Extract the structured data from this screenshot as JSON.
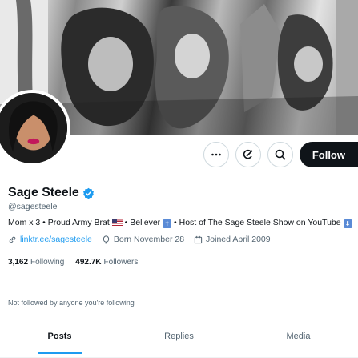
{
  "profile": {
    "display_name": "Sage Steele",
    "handle": "@sagesteele",
    "verified": true,
    "bio_part1": "Mom x 3 • Proud Army Brat",
    "bio_part2": "• Believer",
    "bio_part3": "• Host of The Sage Steele Show on YouTube",
    "bio_emoji_cross": "✝",
    "bio_emoji_arrow": "⬇",
    "website": "linktr.ee/sagesteele",
    "birthday": "Born November 28",
    "joined": "Joined April 2009"
  },
  "stats": {
    "following_count": "3,162",
    "following_label": "Following",
    "followers_count": "492.7K",
    "followers_label": "Followers"
  },
  "not_followed_text": "Not followed by anyone you're following",
  "actions": {
    "more_icon": "more-icon",
    "grok_icon": "grok-icon",
    "search_icon": "search-icon",
    "follow_label": "Follow"
  },
  "tabs": [
    {
      "label": "Posts",
      "active": true
    },
    {
      "label": "Replies",
      "active": false
    },
    {
      "label": "Media",
      "active": false
    }
  ],
  "colors": {
    "accent": "#1d9bf0",
    "text": "#0f1419",
    "secondary": "#536471",
    "follow_bg": "#0f1419"
  }
}
